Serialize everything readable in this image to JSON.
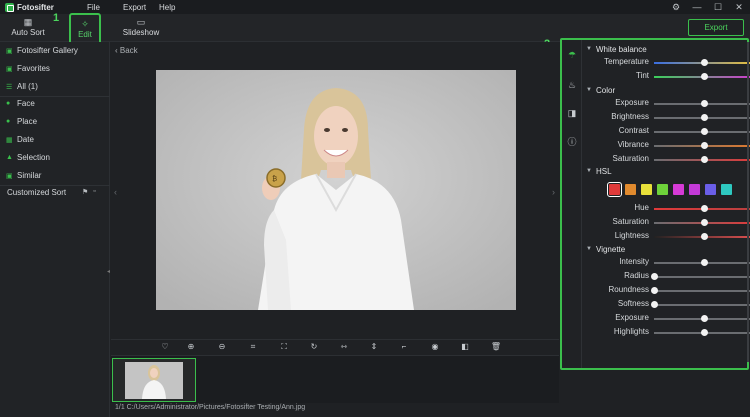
{
  "app": {
    "title": "Fotosifter"
  },
  "menu": [
    "File",
    "Export",
    "Help"
  ],
  "toolbar": {
    "auto_sort": "Auto Sort",
    "edit": "Edit",
    "slideshow": "Slideshow",
    "export": "Export",
    "step1": "1",
    "step2": "2"
  },
  "sidebar": {
    "items": [
      {
        "label": "Fotosifter Gallery",
        "icon": "gallery-icon"
      },
      {
        "label": "Favorites",
        "icon": "favorites-icon"
      },
      {
        "label": "All (1)",
        "icon": "list-icon"
      },
      {
        "label": "Face",
        "icon": "face-icon"
      },
      {
        "label": "Place",
        "icon": "place-icon"
      },
      {
        "label": "Date",
        "icon": "calendar-icon"
      },
      {
        "label": "Selection",
        "icon": "selection-icon"
      },
      {
        "label": "Similar",
        "icon": "similar-icon"
      }
    ],
    "customized_sort": "Customized Sort"
  },
  "main": {
    "back": "Back",
    "path": "1/1  C:/Users/Administrator/Pictures/Fotosifter Testing/Ann.jpg"
  },
  "bottom_tools": [
    "heart-icon",
    "zoom-in-icon",
    "zoom-out-icon",
    "fit-icon",
    "fullscreen-icon",
    "rotate-icon",
    "flip-horizontal-icon",
    "flip-vertical-icon",
    "crop-icon",
    "eye-icon",
    "compare-icon",
    "delete-icon"
  ],
  "panel": {
    "white_balance": {
      "title": "White balance",
      "sliders": [
        {
          "label": "Temperature",
          "value": 0.5
        },
        {
          "label": "Tint",
          "value": 0.5
        }
      ]
    },
    "color": {
      "title": "Color",
      "sliders": [
        {
          "label": "Exposure",
          "value": 0.5
        },
        {
          "label": "Brightness",
          "value": 0.5
        },
        {
          "label": "Contrast",
          "value": 0.5
        },
        {
          "label": "Vibrance",
          "value": 0.5
        },
        {
          "label": "Saturation",
          "value": 0.5
        }
      ]
    },
    "hsl": {
      "title": "HSL",
      "swatches": [
        "#e03a3a",
        "#e08a2e",
        "#e8e03a",
        "#6ed23a",
        "#d63ad6",
        "#c43ad8",
        "#6a5ee8",
        "#2ec8c0"
      ],
      "sliders": [
        {
          "label": "Hue",
          "value": 0.5
        },
        {
          "label": "Saturation",
          "value": 0.5
        },
        {
          "label": "Lightness",
          "value": 0.5
        }
      ]
    },
    "vignette": {
      "title": "Vignette",
      "sliders": [
        {
          "label": "Intensity",
          "value": 0.5
        },
        {
          "label": "Radius",
          "value": 0.0
        },
        {
          "label": "Roundness",
          "value": 0.0
        },
        {
          "label": "Softness",
          "value": 0.0
        },
        {
          "label": "Exposure",
          "value": 0.5
        },
        {
          "label": "Highlights",
          "value": 0.5
        }
      ]
    }
  },
  "colors": {
    "accent": "#3bbf4c"
  }
}
